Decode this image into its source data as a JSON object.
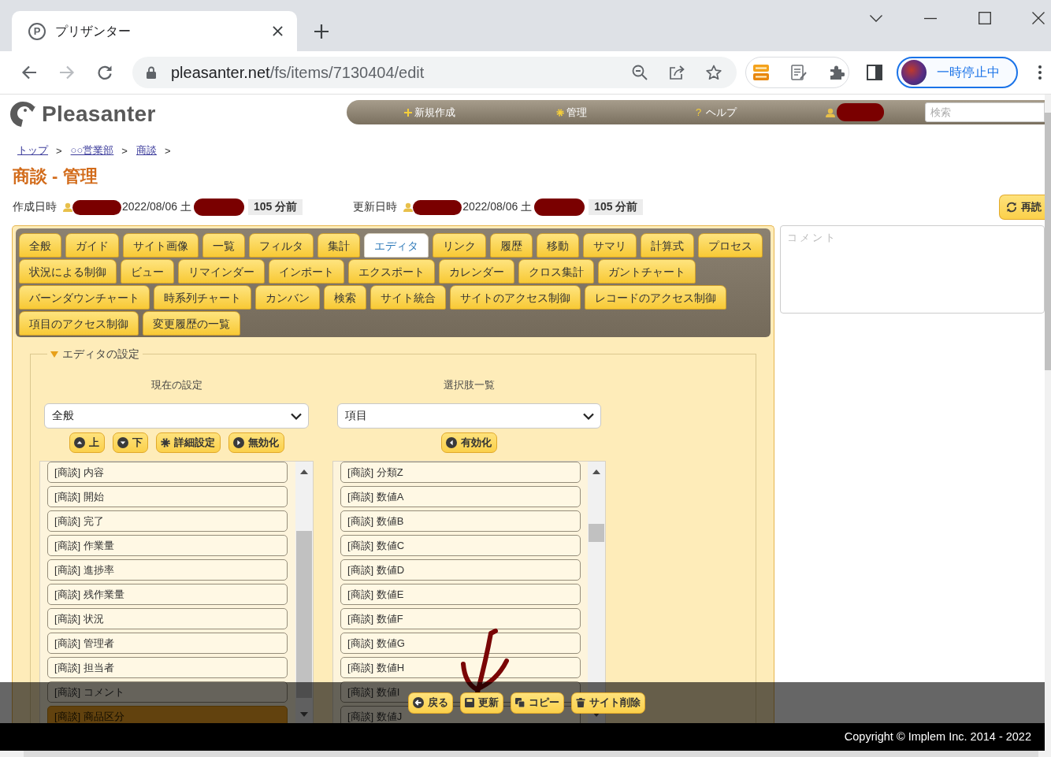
{
  "browser": {
    "tab": {
      "icon_letter": "P",
      "title": "プリザンター"
    },
    "url": {
      "host": "pleasanter.net",
      "path": "/fs/items/7130404/edit"
    },
    "profile": {
      "label": "一時停止中"
    }
  },
  "header": {
    "logo": "Pleasanter",
    "nav": [
      {
        "kind": "new",
        "label": "新規作成"
      },
      {
        "kind": "manage",
        "label": "管理"
      },
      {
        "kind": "help",
        "mark": "?",
        "label": "ヘルプ"
      },
      {
        "kind": "user"
      }
    ],
    "search": {
      "placeholder": "検索"
    }
  },
  "breadcrumb": [
    {
      "label": "トップ",
      "separator": ">"
    },
    {
      "label": "○○営業部",
      "separator": ">"
    },
    {
      "label": "商談",
      "separator": ">"
    }
  ],
  "title": "商談 - 管理",
  "meta": [
    {
      "label": "作成日時",
      "date": "2022/08/06 土",
      "ago": "105 分前"
    },
    {
      "label": "更新日時",
      "date": "2022/08/06 土",
      "ago": "105 分前"
    }
  ],
  "reload_button": {
    "label": "再読"
  },
  "tab_rows": [
    [
      {
        "label": "全般",
        "selected": false
      },
      {
        "label": "ガイド",
        "selected": false
      },
      {
        "label": "サイト画像",
        "selected": false
      },
      {
        "label": "一覧",
        "selected": false
      },
      {
        "label": "フィルタ",
        "selected": false
      },
      {
        "label": "集計",
        "selected": false
      },
      {
        "label": "エディタ",
        "selected": true
      },
      {
        "label": "リンク",
        "selected": false
      },
      {
        "label": "履歴",
        "selected": false
      },
      {
        "label": "移動",
        "selected": false
      },
      {
        "label": "サマリ",
        "selected": false
      },
      {
        "label": "計算式",
        "selected": false
      },
      {
        "label": "プロセス",
        "selected": false
      }
    ],
    [
      {
        "label": "状況による制御",
        "selected": false
      },
      {
        "label": "ビュー",
        "selected": false
      },
      {
        "label": "リマインダー",
        "selected": false
      },
      {
        "label": "インポート",
        "selected": false
      },
      {
        "label": "エクスポート",
        "selected": false
      },
      {
        "label": "カレンダー",
        "selected": false
      },
      {
        "label": "クロス集計",
        "selected": false
      },
      {
        "label": "ガントチャート",
        "selected": false
      }
    ],
    [
      {
        "label": "バーンダウンチャート",
        "selected": false
      },
      {
        "label": "時系列チャート",
        "selected": false
      },
      {
        "label": "カンバン",
        "selected": false
      },
      {
        "label": "検索",
        "selected": false
      },
      {
        "label": "サイト統合",
        "selected": false
      },
      {
        "label": "サイトのアクセス制御",
        "selected": false
      },
      {
        "label": "レコードのアクセス制御",
        "selected": false
      }
    ],
    [
      {
        "label": "項目のアクセス制御",
        "selected": false
      },
      {
        "label": "変更履歴の一覧",
        "selected": false
      }
    ]
  ],
  "comment": {
    "placeholder": "コメント"
  },
  "editor": {
    "legend": "エディタの設定",
    "expanded": true,
    "columns": [
      {
        "heading": "現在の設定",
        "select": "全般",
        "buttons": [
          {
            "kind": "up",
            "label": "上"
          },
          {
            "kind": "down",
            "label": "下"
          },
          {
            "kind": "settings",
            "label": "詳細設定"
          },
          {
            "kind": "disable",
            "label": "無効化"
          }
        ],
        "items": [
          {
            "label": "[商談] 内容",
            "selected": false
          },
          {
            "label": "[商談] 開始",
            "selected": false
          },
          {
            "label": "[商談] 完了",
            "selected": false
          },
          {
            "label": "[商談] 作業量",
            "selected": false
          },
          {
            "label": "[商談] 進捗率",
            "selected": false
          },
          {
            "label": "[商談] 残作業量",
            "selected": false
          },
          {
            "label": "[商談] 状況",
            "selected": false
          },
          {
            "label": "[商談] 管理者",
            "selected": false
          },
          {
            "label": "[商談] 担当者",
            "selected": false
          },
          {
            "label": "[商談] コメント",
            "selected": false
          },
          {
            "label": "[商談] 商品区分",
            "selected": true
          }
        ]
      },
      {
        "heading": "選択肢一覧",
        "select": "項目",
        "buttons": [
          {
            "kind": "enable",
            "label": "有効化"
          }
        ],
        "items": [
          {
            "label": "[商談] 分類Z",
            "selected": false
          },
          {
            "label": "[商談] 数値A",
            "selected": false
          },
          {
            "label": "[商談] 数値B",
            "selected": false
          },
          {
            "label": "[商談] 数値C",
            "selected": false
          },
          {
            "label": "[商談] 数値D",
            "selected": false
          },
          {
            "label": "[商談] 数値E",
            "selected": false
          },
          {
            "label": "[商談] 数値F",
            "selected": false
          },
          {
            "label": "[商談] 数値G",
            "selected": false
          },
          {
            "label": "[商談] 数値H",
            "selected": false
          },
          {
            "label": "[商談] 数値I",
            "selected": false
          },
          {
            "label": "[商談] 数値J",
            "selected": false
          }
        ]
      }
    ]
  },
  "actions": [
    {
      "kind": "back",
      "label": "戻る"
    },
    {
      "kind": "save",
      "label": "更新"
    },
    {
      "kind": "copy",
      "label": "コピー"
    },
    {
      "kind": "delete",
      "label": "サイト削除"
    }
  ],
  "footer": "Copyright © Implem Inc. 2014 - 2022"
}
